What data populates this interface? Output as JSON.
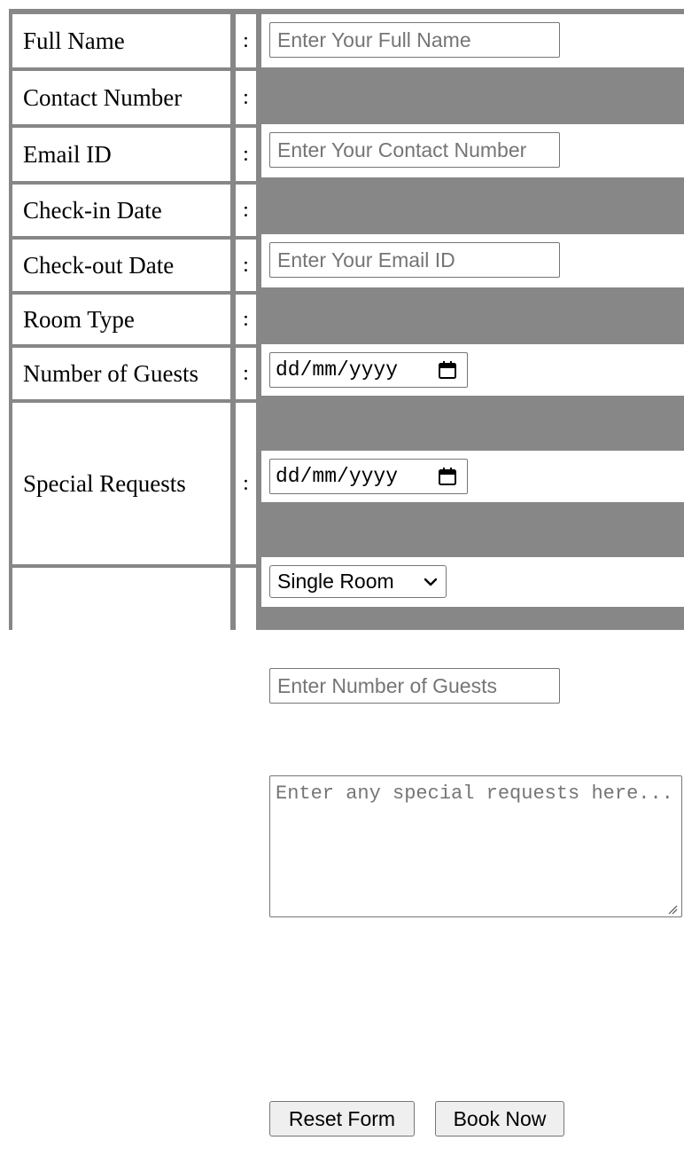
{
  "form": {
    "colon": ":",
    "full_name": {
      "label": "Full Name",
      "placeholder": "Enter Your Full Name"
    },
    "contact_number": {
      "label": "Contact Number",
      "placeholder": "Enter Your Contact Number"
    },
    "email": {
      "label": "Email ID",
      "placeholder": "Enter Your Email ID"
    },
    "check_in": {
      "label": "Check-in Date",
      "value_format": "dd/mm/yyyy",
      "icon": "calendar-icon"
    },
    "check_out": {
      "label": "Check-out Date",
      "value_format": "dd/mm/yyyy",
      "icon": "calendar-icon"
    },
    "room_type": {
      "label": "Room Type",
      "selected": "Single Room",
      "icon": "chevron-down-icon"
    },
    "guests": {
      "label": "Number of Guests",
      "placeholder": "Enter Number of Guests"
    },
    "special_requests": {
      "label": "Special Requests",
      "placeholder": "Enter any special requests here..."
    },
    "buttons": {
      "reset": "Reset Form",
      "submit": "Book Now"
    }
  },
  "colors": {
    "table_border": "#878787",
    "button_bg": "#efefef",
    "input_border": "#767676",
    "placeholder_text": "#757575"
  }
}
